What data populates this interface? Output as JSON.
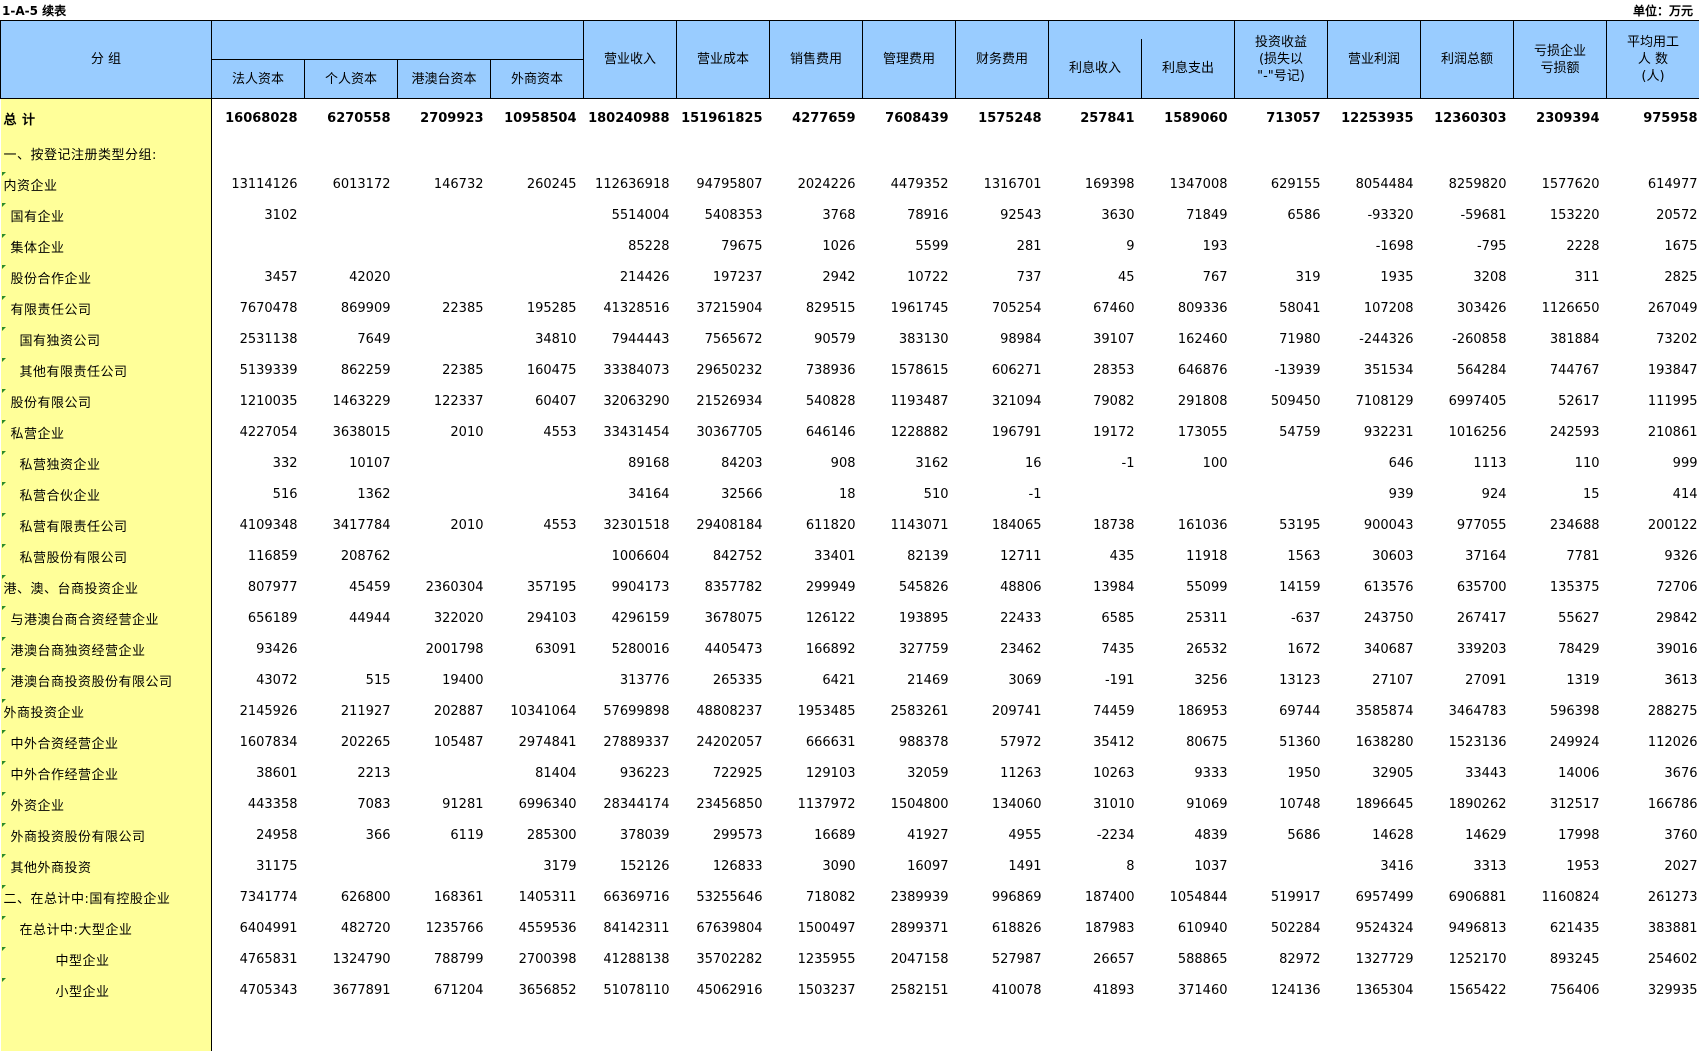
{
  "sheet": {
    "title": "1-A-5  续表",
    "unit": "单位：万元"
  },
  "headers": {
    "group": "分  组",
    "capital_sub": [
      "法人资本",
      "个人资本",
      "港澳台资本",
      "外商资本"
    ],
    "cols": [
      "营业收入",
      "营业成本",
      "销售费用",
      "管理费用",
      "财务费用"
    ],
    "interest_in": "利息收入",
    "interest_out": "利息支出",
    "invest_gain": "投资收益\n(损失以\n\"-\"号记)",
    "op_profit": "营业利润",
    "total_profit": "利润总额",
    "loss_ent": "亏损企业\n亏损额",
    "employees": "平均用工\n人  数\n(人)"
  },
  "rows": [
    {
      "label": "总  计",
      "indent": 0,
      "values": [
        "16068028",
        "6270558",
        "2709923",
        "10958504",
        "180240988",
        "151961825",
        "4277659",
        "7608439",
        "1575248",
        "257841",
        "1589060",
        "713057",
        "12253935",
        "12360303",
        "2309394",
        "975958"
      ]
    },
    {
      "label": "一、按登记注册类型分组:",
      "indent": 0,
      "values": [
        "",
        "",
        "",
        "",
        "",
        "",
        "",
        "",
        "",
        "",
        "",
        "",
        "",
        "",
        "",
        ""
      ]
    },
    {
      "label": "内资企业",
      "indent": 0,
      "values": [
        "13114126",
        "6013172",
        "146732",
        "260245",
        "112636918",
        "94795807",
        "2024226",
        "4479352",
        "1316701",
        "169398",
        "1347008",
        "629155",
        "8054484",
        "8259820",
        "1577620",
        "614977"
      ]
    },
    {
      "label": "国有企业",
      "indent": 1,
      "values": [
        "3102",
        "",
        "",
        "",
        "5514004",
        "5408353",
        "3768",
        "78916",
        "92543",
        "3630",
        "71849",
        "6586",
        "-93320",
        "-59681",
        "153220",
        "20572"
      ]
    },
    {
      "label": "集体企业",
      "indent": 1,
      "values": [
        "",
        "",
        "",
        "",
        "85228",
        "79675",
        "1026",
        "5599",
        "281",
        "9",
        "193",
        "",
        "-1698",
        "-795",
        "2228",
        "1675"
      ]
    },
    {
      "label": "股份合作企业",
      "indent": 1,
      "values": [
        "3457",
        "42020",
        "",
        "",
        "214426",
        "197237",
        "2942",
        "10722",
        "737",
        "45",
        "767",
        "319",
        "1935",
        "3208",
        "311",
        "2825"
      ]
    },
    {
      "label": "有限责任公司",
      "indent": 1,
      "values": [
        "7670478",
        "869909",
        "22385",
        "195285",
        "41328516",
        "37215904",
        "829515",
        "1961745",
        "705254",
        "67460",
        "809336",
        "58041",
        "107208",
        "303426",
        "1126650",
        "267049"
      ]
    },
    {
      "label": "国有独资公司",
      "indent": 2,
      "values": [
        "2531138",
        "7649",
        "",
        "34810",
        "7944443",
        "7565672",
        "90579",
        "383130",
        "98984",
        "39107",
        "162460",
        "71980",
        "-244326",
        "-260858",
        "381884",
        "73202"
      ]
    },
    {
      "label": "其他有限责任公司",
      "indent": 2,
      "values": [
        "5139339",
        "862259",
        "22385",
        "160475",
        "33384073",
        "29650232",
        "738936",
        "1578615",
        "606271",
        "28353",
        "646876",
        "-13939",
        "351534",
        "564284",
        "744767",
        "193847"
      ]
    },
    {
      "label": "股份有限公司",
      "indent": 1,
      "values": [
        "1210035",
        "1463229",
        "122337",
        "60407",
        "32063290",
        "21526934",
        "540828",
        "1193487",
        "321094",
        "79082",
        "291808",
        "509450",
        "7108129",
        "6997405",
        "52617",
        "111995"
      ]
    },
    {
      "label": "私营企业",
      "indent": 1,
      "values": [
        "4227054",
        "3638015",
        "2010",
        "4553",
        "33431454",
        "30367705",
        "646146",
        "1228882",
        "196791",
        "19172",
        "173055",
        "54759",
        "932231",
        "1016256",
        "242593",
        "210861"
      ]
    },
    {
      "label": "私营独资企业",
      "indent": 2,
      "values": [
        "332",
        "10107",
        "",
        "",
        "89168",
        "84203",
        "908",
        "3162",
        "16",
        "-1",
        "100",
        "",
        "646",
        "1113",
        "110",
        "999"
      ]
    },
    {
      "label": "私营合伙企业",
      "indent": 2,
      "values": [
        "516",
        "1362",
        "",
        "",
        "34164",
        "32566",
        "18",
        "510",
        "-1",
        "",
        "",
        "",
        "939",
        "924",
        "15",
        "414"
      ]
    },
    {
      "label": "私营有限责任公司",
      "indent": 2,
      "values": [
        "4109348",
        "3417784",
        "2010",
        "4553",
        "32301518",
        "29408184",
        "611820",
        "1143071",
        "184065",
        "18738",
        "161036",
        "53195",
        "900043",
        "977055",
        "234688",
        "200122"
      ]
    },
    {
      "label": "私营股份有限公司",
      "indent": 2,
      "values": [
        "116859",
        "208762",
        "",
        "",
        "1006604",
        "842752",
        "33401",
        "82139",
        "12711",
        "435",
        "11918",
        "1563",
        "30603",
        "37164",
        "7781",
        "9326"
      ]
    },
    {
      "label": "港、澳、台商投资企业",
      "indent": 0,
      "values": [
        "807977",
        "45459",
        "2360304",
        "357195",
        "9904173",
        "8357782",
        "299949",
        "545826",
        "48806",
        "13984",
        "55099",
        "14159",
        "613576",
        "635700",
        "135375",
        "72706"
      ]
    },
    {
      "label": "与港澳台商合资经营企业",
      "indent": 1,
      "values": [
        "656189",
        "44944",
        "322020",
        "294103",
        "4296159",
        "3678075",
        "126122",
        "193895",
        "22433",
        "6585",
        "25311",
        "-637",
        "243750",
        "267417",
        "55627",
        "29842"
      ]
    },
    {
      "label": "港澳台商独资经营企业",
      "indent": 1,
      "values": [
        "93426",
        "",
        "2001798",
        "63091",
        "5280016",
        "4405473",
        "166892",
        "327759",
        "23462",
        "7435",
        "26532",
        "1672",
        "340687",
        "339203",
        "78429",
        "39016"
      ]
    },
    {
      "label": "港澳台商投资股份有限公司",
      "indent": 1,
      "values": [
        "43072",
        "515",
        "19400",
        "",
        "313776",
        "265335",
        "6421",
        "21469",
        "3069",
        "-191",
        "3256",
        "13123",
        "27107",
        "27091",
        "1319",
        "3613"
      ]
    },
    {
      "label": "外商投资企业",
      "indent": 0,
      "values": [
        "2145926",
        "211927",
        "202887",
        "10341064",
        "57699898",
        "48808237",
        "1953485",
        "2583261",
        "209741",
        "74459",
        "186953",
        "69744",
        "3585874",
        "3464783",
        "596398",
        "288275"
      ]
    },
    {
      "label": "中外合资经营企业",
      "indent": 1,
      "values": [
        "1607834",
        "202265",
        "105487",
        "2974841",
        "27889337",
        "24202057",
        "666631",
        "988378",
        "57972",
        "35412",
        "80675",
        "51360",
        "1638280",
        "1523136",
        "249924",
        "112026"
      ]
    },
    {
      "label": "中外合作经营企业",
      "indent": 1,
      "values": [
        "38601",
        "2213",
        "",
        "81404",
        "936223",
        "722925",
        "129103",
        "32059",
        "11263",
        "10263",
        "9333",
        "1950",
        "32905",
        "33443",
        "14006",
        "3676"
      ]
    },
    {
      "label": "外资企业",
      "indent": 1,
      "values": [
        "443358",
        "7083",
        "91281",
        "6996340",
        "28344174",
        "23456850",
        "1137972",
        "1504800",
        "134060",
        "31010",
        "91069",
        "10748",
        "1896645",
        "1890262",
        "312517",
        "166786"
      ]
    },
    {
      "label": "外商投资股份有限公司",
      "indent": 1,
      "values": [
        "24958",
        "366",
        "6119",
        "285300",
        "378039",
        "299573",
        "16689",
        "41927",
        "4955",
        "-2234",
        "4839",
        "5686",
        "14628",
        "14629",
        "17998",
        "3760"
      ]
    },
    {
      "label": "其他外商投资",
      "indent": 1,
      "values": [
        "31175",
        "",
        "",
        "3179",
        "152126",
        "126833",
        "3090",
        "16097",
        "1491",
        "8",
        "1037",
        "",
        "3416",
        "3313",
        "1953",
        "2027"
      ]
    },
    {
      "label": "二、在总计中:国有控股企业",
      "indent": 0,
      "values": [
        "7341774",
        "626800",
        "168361",
        "1405311",
        "66369716",
        "53255646",
        "718082",
        "2389939",
        "996869",
        "187400",
        "1054844",
        "519917",
        "6957499",
        "6906881",
        "1160824",
        "261273"
      ]
    },
    {
      "label": "在总计中:大型企业",
      "indent": 2,
      "values": [
        "6404991",
        "482720",
        "1235766",
        "4559536",
        "84142311",
        "67639804",
        "1500497",
        "2899371",
        "618826",
        "187983",
        "610940",
        "502284",
        "9524324",
        "9496813",
        "621435",
        "383881"
      ]
    },
    {
      "label": "中型企业",
      "indent": 4,
      "values": [
        "4765831",
        "1324790",
        "788799",
        "2700398",
        "41288138",
        "35702282",
        "1235955",
        "2047158",
        "527987",
        "26657",
        "588865",
        "82972",
        "1327729",
        "1252170",
        "893245",
        "254602"
      ]
    },
    {
      "label": "小型企业",
      "indent": 4,
      "values": [
        "4705343",
        "3677891",
        "671204",
        "3656852",
        "51078110",
        "45062916",
        "1503237",
        "2582151",
        "410078",
        "41893",
        "371460",
        "124136",
        "1365304",
        "1565422",
        "756406",
        "329935"
      ]
    }
  ]
}
